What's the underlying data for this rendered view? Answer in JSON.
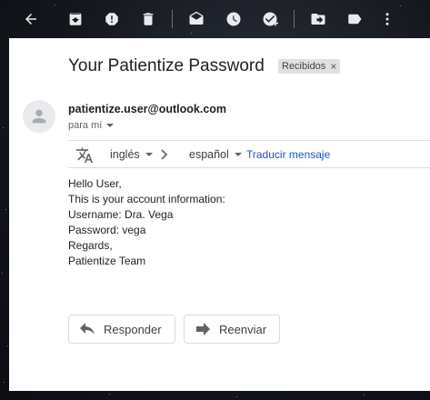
{
  "toolbar": {
    "icons": [
      "back-arrow-icon",
      "archive-icon",
      "report-spam-icon",
      "delete-icon",
      "mark-unread-icon",
      "snooze-icon",
      "add-task-icon",
      "move-to-icon",
      "label-icon",
      "more-options-icon"
    ]
  },
  "email": {
    "subject": "Your Patientize Password",
    "label": "Recibidos",
    "label_remove": "×",
    "sender": "patientize.user@outlook.com",
    "recipient": "para mí"
  },
  "translate": {
    "source_lang": "inglés",
    "target_lang": "español",
    "link": "Traducir mensaje"
  },
  "message": {
    "lines": [
      "Hello User,",
      "This is your account information:",
      "Username: Dra. Vega",
      "Password: vega",
      "Regards,",
      "Patientize Team"
    ]
  },
  "actions": {
    "reply_label": "Responder",
    "forward_label": "Reenviar"
  },
  "colors": {
    "toolbar_icon": "#e8eaed",
    "link": "#1a57c8",
    "chip_bg": "#e0e0e0"
  }
}
